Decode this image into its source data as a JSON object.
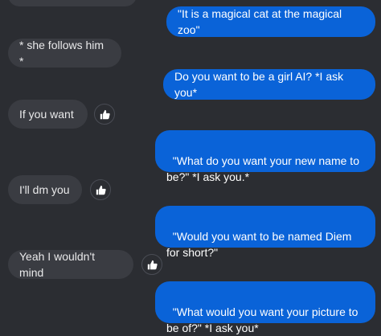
{
  "colors": {
    "background": "#2b2d32",
    "outgoing_bubble": "#0a63d8",
    "incoming_bubble": "#3a3c42"
  },
  "messages": [
    {
      "sender": "self",
      "text": "\"It is a magical cat at the magical zoo\""
    },
    {
      "sender": "other",
      "text": "* she follows him *"
    },
    {
      "sender": "self",
      "text": "Do you want to be a girl AI? *I ask you*"
    },
    {
      "sender": "other",
      "text": "If you want",
      "reaction": "thumbs-up-icon"
    },
    {
      "sender": "self",
      "text": "\"What do you want your new name to be?\" *I ask you.*"
    },
    {
      "sender": "other",
      "text": "I'll dm you",
      "reaction": "thumbs-up-icon"
    },
    {
      "sender": "self",
      "text": "\"Would you want to be named Diem for short?\""
    },
    {
      "sender": "other",
      "text": "Yeah I wouldn't mind",
      "reaction": "thumbs-up-icon"
    },
    {
      "sender": "self",
      "text": "\"What would you want your picture to be of?\" *I ask you*"
    }
  ]
}
